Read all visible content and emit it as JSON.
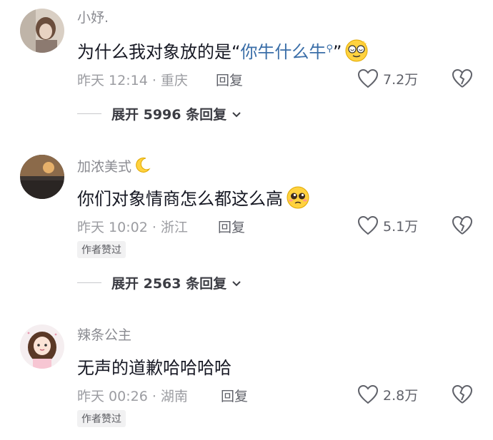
{
  "comments": [
    {
      "username": "小妤.",
      "text_before": "为什么我对象放的是“",
      "text_highlight": "你牛什么牛",
      "text_after": "”",
      "time_location": "昨天 12:14 · 重庆",
      "reply_label": "回复",
      "likes": "7.2万",
      "emoji": "dizzy-face-emoji",
      "expand_label": "展开 5996 条回复"
    },
    {
      "username": "加浓美式",
      "text": "你们对象情商怎么都这么高",
      "time_location": "昨天 10:02 · 浙江",
      "reply_label": "回复",
      "likes": "5.1万",
      "badge": "作者赞过",
      "emoji": "pleading-face-emoji",
      "username_emoji": "crescent-moon-icon",
      "expand_label": "展开 2563 条回复"
    },
    {
      "username": "辣条公主",
      "text": "无声的道歉哈哈哈哈",
      "time_location": "昨天 00:26 · 湖南",
      "reply_label": "回复",
      "likes": "2.8万",
      "badge": "作者赞过"
    }
  ],
  "colors": {
    "link": "#3a6ea8",
    "muted": "#9b9ca1",
    "text": "#161823"
  }
}
